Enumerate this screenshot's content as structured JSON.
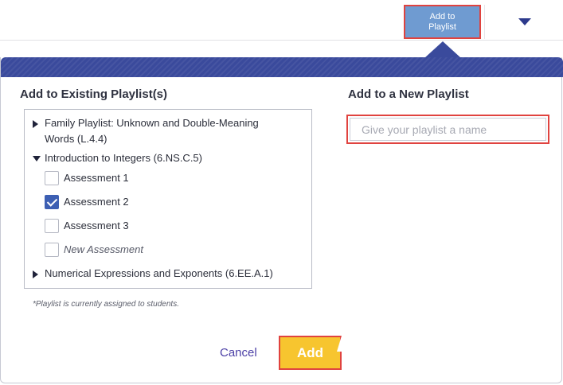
{
  "toolbar": {
    "add_to_playlist_label": "Add to Playlist"
  },
  "existing": {
    "title": "Add to Existing Playlist(s)",
    "playlists": [
      {
        "label_line1": "Family Playlist: Unknown and Double-Meaning",
        "label_line2": "Words (L.4.4)",
        "expanded": false
      },
      {
        "label": "Introduction to Integers (6.NS.C.5)",
        "expanded": true,
        "assessments": [
          {
            "label": "Assessment 1",
            "checked": false
          },
          {
            "label": "Assessment 2",
            "checked": true
          },
          {
            "label": "Assessment 3",
            "checked": false
          },
          {
            "label": "New Assessment",
            "checked": false
          }
        ]
      },
      {
        "label": "Numerical Expressions and Exponents (6.EE.A.1)",
        "expanded": false
      }
    ],
    "note": "*Playlist is currently assigned to students."
  },
  "new_playlist": {
    "title": "Add to a New Playlist",
    "placeholder": "Give your playlist a name",
    "value": ""
  },
  "footer": {
    "cancel_label": "Cancel",
    "add_label": "Add"
  },
  "colors": {
    "header_blue": "#3a4a9c",
    "button_blue": "#6f9bd1",
    "add_yellow": "#f7c52f",
    "highlight_red": "#e0433f",
    "checkbox_blue": "#3d5fb3"
  }
}
